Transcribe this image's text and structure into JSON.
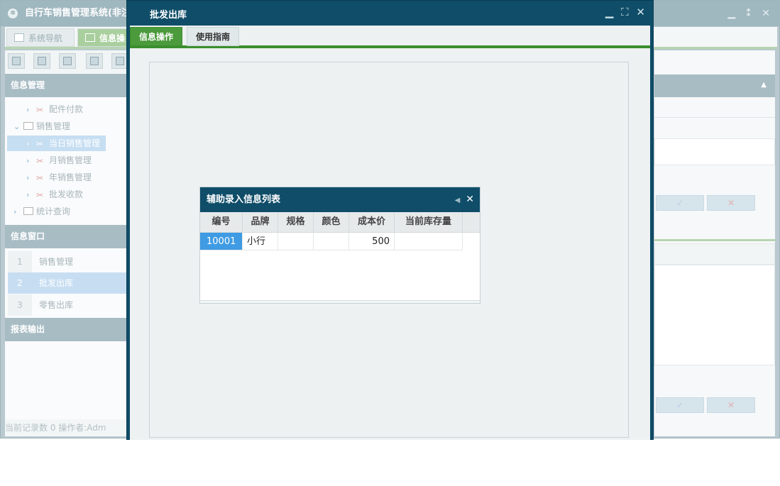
{
  "background_app": {
    "title": "自行车销售管理系统(非注",
    "top_tabs": [
      {
        "label": "系统导航"
      },
      {
        "label": "信息操"
      }
    ],
    "panels": {
      "info_mgmt": "信息管理",
      "info_window": "信息窗口",
      "report": "报表输出"
    },
    "tree": [
      {
        "label": "配件付款",
        "type": "leaf"
      },
      {
        "label": "销售管理",
        "type": "folder"
      },
      {
        "label": "当日销售管理",
        "type": "leaf",
        "selected": true
      },
      {
        "label": "月销售管理",
        "type": "leaf"
      },
      {
        "label": "年销售管理",
        "type": "leaf"
      },
      {
        "label": "批发收款",
        "type": "leaf"
      },
      {
        "label": "统计查询",
        "type": "folder"
      }
    ],
    "windows": [
      {
        "num": "1",
        "label": "销售管理"
      },
      {
        "num": "2",
        "label": "批发出库",
        "selected": true
      },
      {
        "num": "3",
        "label": "零售出库"
      }
    ],
    "status_text": "当前记录数 0     操作者:Adm"
  },
  "modal": {
    "title": "批发出库",
    "tabs": [
      {
        "label": "信息操作",
        "active": true
      },
      {
        "label": "使用指南",
        "active": false
      }
    ]
  },
  "popup": {
    "title": "辅助录入信息列表",
    "columns": [
      "编号",
      "品牌",
      "规格",
      "颜色",
      "成本价",
      "当前库存量"
    ],
    "rows": [
      {
        "id": "10001",
        "brand": "小行",
        "spec": "",
        "color": "",
        "cost": "500",
        "stock": ""
      }
    ]
  },
  "colors": {
    "modal_header": "#0f4d68",
    "active_tab": "#4b9a3c",
    "selected_cell": "#3f9be3"
  }
}
